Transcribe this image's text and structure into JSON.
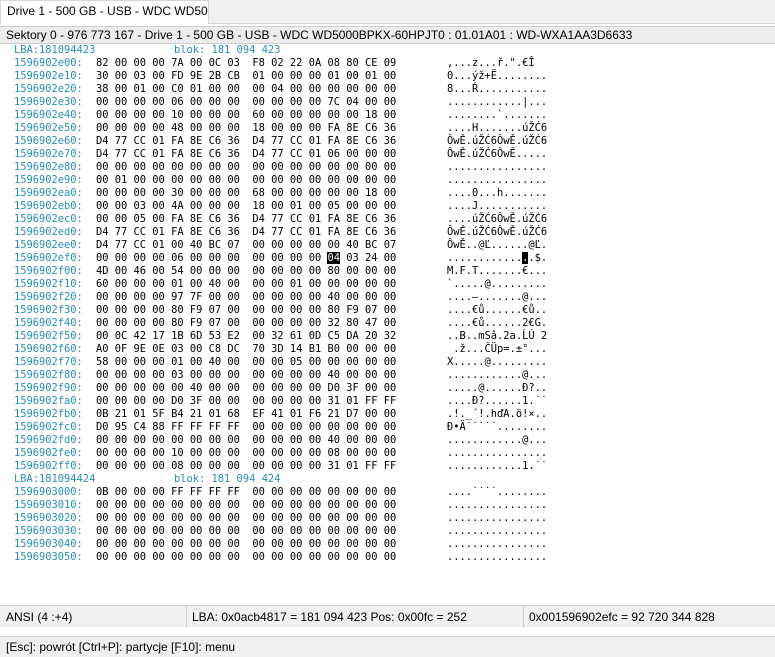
{
  "tab": {
    "label": "Drive 1 - 500 GB - USB - WDC WD50..."
  },
  "header": {
    "text": "Sektory 0 - 976 773 167 - Drive 1 - 500 GB - USB - WDC WD5000BPKX-60HPJT0 : 01.01A01 : WD-WXA1AA3D6633"
  },
  "hexview": {
    "rows": [
      {
        "kind": "lba",
        "lba": "LBA:181094423",
        "blok": "blok: 181 094 423"
      },
      {
        "kind": "data",
        "offset": "1596902e00:",
        "hex": "82 00 00 00 7A 00 0C 03  F8 02 22 0A 08 80 CE 09",
        "ascii": ",...z...ř.\".€Î"
      },
      {
        "kind": "data",
        "offset": "1596902e10:",
        "hex": "30 00 03 00 FD 9E 2B CB  01 00 00 00 01 00 01 00",
        "ascii": "0...ýž+Ë........"
      },
      {
        "kind": "data",
        "offset": "1596902e20:",
        "hex": "38 00 01 00 C0 01 00 00  00 04 00 00 00 00 00 00",
        "ascii": "8...Ŕ..........."
      },
      {
        "kind": "data",
        "offset": "1596902e30:",
        "hex": "00 00 00 00 06 00 00 00  00 00 00 00 7C 04 00 00",
        "ascii": "............|..."
      },
      {
        "kind": "data",
        "offset": "1596902e40:",
        "hex": "00 00 00 00 10 00 00 00  60 00 00 00 00 00 18 00",
        "ascii": "........`......."
      },
      {
        "kind": "data",
        "offset": "1596902e50:",
        "hex": "00 00 00 00 48 00 00 00  18 00 00 00 FA 8E C6 36",
        "ascii": "....H.......úŽĆ6"
      },
      {
        "kind": "data",
        "offset": "1596902e60:",
        "hex": "D4 77 CC 01 FA 8E C6 36  D4 77 CC 01 FA 8E C6 36",
        "ascii": "ÔwĚ.úŽĆ6ÔwĚ.úŽĆ6"
      },
      {
        "kind": "data",
        "offset": "1596902e70:",
        "hex": "D4 77 CC 01 FA 8E C6 36  D4 77 CC 01 06 00 00 00",
        "ascii": "ÔwĚ.úŽĆ6ÔwĚ....."
      },
      {
        "kind": "data",
        "offset": "1596902e80:",
        "hex": "00 00 00 00 00 00 00 00  00 00 00 00 00 00 00 00",
        "ascii": "................"
      },
      {
        "kind": "data",
        "offset": "1596902e90:",
        "hex": "00 01 00 00 00 00 00 00  00 00 00 00 00 00 00 00",
        "ascii": "................"
      },
      {
        "kind": "data",
        "offset": "1596902ea0:",
        "hex": "00 00 00 00 30 00 00 00  68 00 00 00 00 00 18 00",
        "ascii": "....0...h......."
      },
      {
        "kind": "data",
        "offset": "1596902eb0:",
        "hex": "00 00 03 00 4A 00 00 00  18 00 01 00 05 00 00 00",
        "ascii": "....J..........."
      },
      {
        "kind": "data",
        "offset": "1596902ec0:",
        "hex": "00 00 05 00 FA 8E C6 36  D4 77 CC 01 FA 8E C6 36",
        "ascii": "....úŽĆ6ÔwĚ.úŽĆ6"
      },
      {
        "kind": "data",
        "offset": "1596902ed0:",
        "hex": "D4 77 CC 01 FA 8E C6 36  D4 77 CC 01 FA 8E C6 36",
        "ascii": "ÔwĚ.úŽĆ6ÔwĚ.úŽĆ6"
      },
      {
        "kind": "data",
        "offset": "1596902ee0:",
        "hex": "D4 77 CC 01 00 40 BC 07  00 00 00 00 00 40 BC 07",
        "ascii": "ÔwĚ..@Ľ......@Ľ."
      },
      {
        "kind": "data",
        "offset": "1596902ef0:",
        "hex_pre": "00 00 00 00 06 00 00 00  00 00 00 00 ",
        "hex_cur": "04",
        "hex_post": " 03 24 00",
        "ascii_pre": "............",
        "ascii_cur": ".",
        "ascii_post": ".$."
      },
      {
        "kind": "data",
        "offset": "1596902f00:",
        "hex": "4D 00 46 00 54 00 00 00  00 00 00 00 80 00 00 00",
        "ascii": "M.F.T.......€..."
      },
      {
        "kind": "data",
        "offset": "1596902f10:",
        "hex": "60 00 00 00 01 00 40 00  00 00 01 00 00 00 00 00",
        "ascii": "`.....@........."
      },
      {
        "kind": "data",
        "offset": "1596902f20:",
        "hex": "00 00 00 00 97 7F 00 00  00 00 00 00 40 00 00 00",
        "ascii": "....—.......@..."
      },
      {
        "kind": "data",
        "offset": "1596902f30:",
        "hex": "00 00 00 00 80 F9 07 00  00 00 00 00 80 F9 07 00",
        "ascii": "....€ů......€ů.."
      },
      {
        "kind": "data",
        "offset": "1596902f40:",
        "hex": "00 00 00 00 80 F9 07 00  00 00 00 00 32 80 47 00",
        "ascii": "....€ů......2€G."
      },
      {
        "kind": "data",
        "offset": "1596902f50:",
        "hex": "00 0C 42 17 1B 6D 53 E2  00 32 61 0D C5 DA 20 32",
        "ascii": "..B..mSâ.2a.ĹÚ 2"
      },
      {
        "kind": "data",
        "offset": "1596902f60:",
        "hex": "A0 0F 9E 0E 03 00 C8 DC  70 3D 14 B1 B0 00 00 00",
        "ascii": " .ž...ČÜp=.±°..."
      },
      {
        "kind": "data",
        "offset": "1596902f70:",
        "hex": "58 00 00 00 01 00 40 00  00 00 05 00 00 00 00 00",
        "ascii": "X.....@........."
      },
      {
        "kind": "data",
        "offset": "1596902f80:",
        "hex": "00 00 00 00 03 00 00 00  00 00 00 00 40 00 00 00",
        "ascii": "............@..."
      },
      {
        "kind": "data",
        "offset": "1596902f90:",
        "hex": "00 00 00 00 00 40 00 00  00 00 00 00 D0 3F 00 00",
        "ascii": ".....@......Đ?.."
      },
      {
        "kind": "data",
        "offset": "1596902fa0:",
        "hex": "00 00 00 00 D0 3F 00 00  00 00 00 00 31 01 FF FF",
        "ascii": "....Đ?......1.˙˙"
      },
      {
        "kind": "data",
        "offset": "1596902fb0:",
        "hex": "0B 21 01 5F B4 21 01 68  EF 41 01 F6 21 D7 00 00",
        "ascii": ".!._´!.hďA.ö!×.."
      },
      {
        "kind": "data",
        "offset": "1596902fc0:",
        "hex": "D0 95 C4 88 FF FF FF FF  00 00 00 00 00 00 00 00",
        "ascii": "Đ•Ä˙˙˙˙˙........"
      },
      {
        "kind": "data",
        "offset": "1596902fd0:",
        "hex": "00 00 00 00 00 00 00 00  00 00 00 00 40 00 00 00",
        "ascii": "............@..."
      },
      {
        "kind": "data",
        "offset": "1596902fe0:",
        "hex": "00 00 00 00 10 00 00 00  00 00 00 00 08 00 00 00",
        "ascii": "................"
      },
      {
        "kind": "data",
        "offset": "1596902ff0:",
        "hex": "00 00 00 00 08 00 00 00  00 00 00 00 31 01 FF FF",
        "ascii": "............1.˙˙"
      },
      {
        "kind": "lba",
        "lba": "LBA:181094424",
        "blok": "blok: 181 094 424"
      },
      {
        "kind": "data",
        "offset": "1596903000:",
        "hex": "0B 00 00 00 FF FF FF FF  00 00 00 00 00 00 00 00",
        "ascii": "....˙˙˙˙........"
      },
      {
        "kind": "data",
        "offset": "1596903010:",
        "hex": "00 00 00 00 00 00 00 00  00 00 00 00 00 00 00 00",
        "ascii": "................"
      },
      {
        "kind": "data",
        "offset": "1596903020:",
        "hex": "00 00 00 00 00 00 00 00  00 00 00 00 00 00 00 00",
        "ascii": "................"
      },
      {
        "kind": "data",
        "offset": "1596903030:",
        "hex": "00 00 00 00 00 00 00 00  00 00 00 00 00 00 00 00",
        "ascii": "................"
      },
      {
        "kind": "data",
        "offset": "1596903040:",
        "hex": "00 00 00 00 00 00 00 00  00 00 00 00 00 00 00 00",
        "ascii": "................"
      },
      {
        "kind": "data",
        "offset": "1596903050:",
        "hex": "00 00 00 00 00 00 00 00  00 00 00 00 00 00 00 00",
        "ascii": "................"
      }
    ]
  },
  "status": {
    "encoding": "ANSI (4 :+4)",
    "lba_pos": "LBA: 0x0acb4817 = 181 094 423  Pos: 0x00fc = 252",
    "abs_offset": "0x001596902efc = 92 720 344 828"
  },
  "footer": {
    "text": "[Esc]: powrót  [Ctrl+P]: partycje  [F10]: menu"
  }
}
